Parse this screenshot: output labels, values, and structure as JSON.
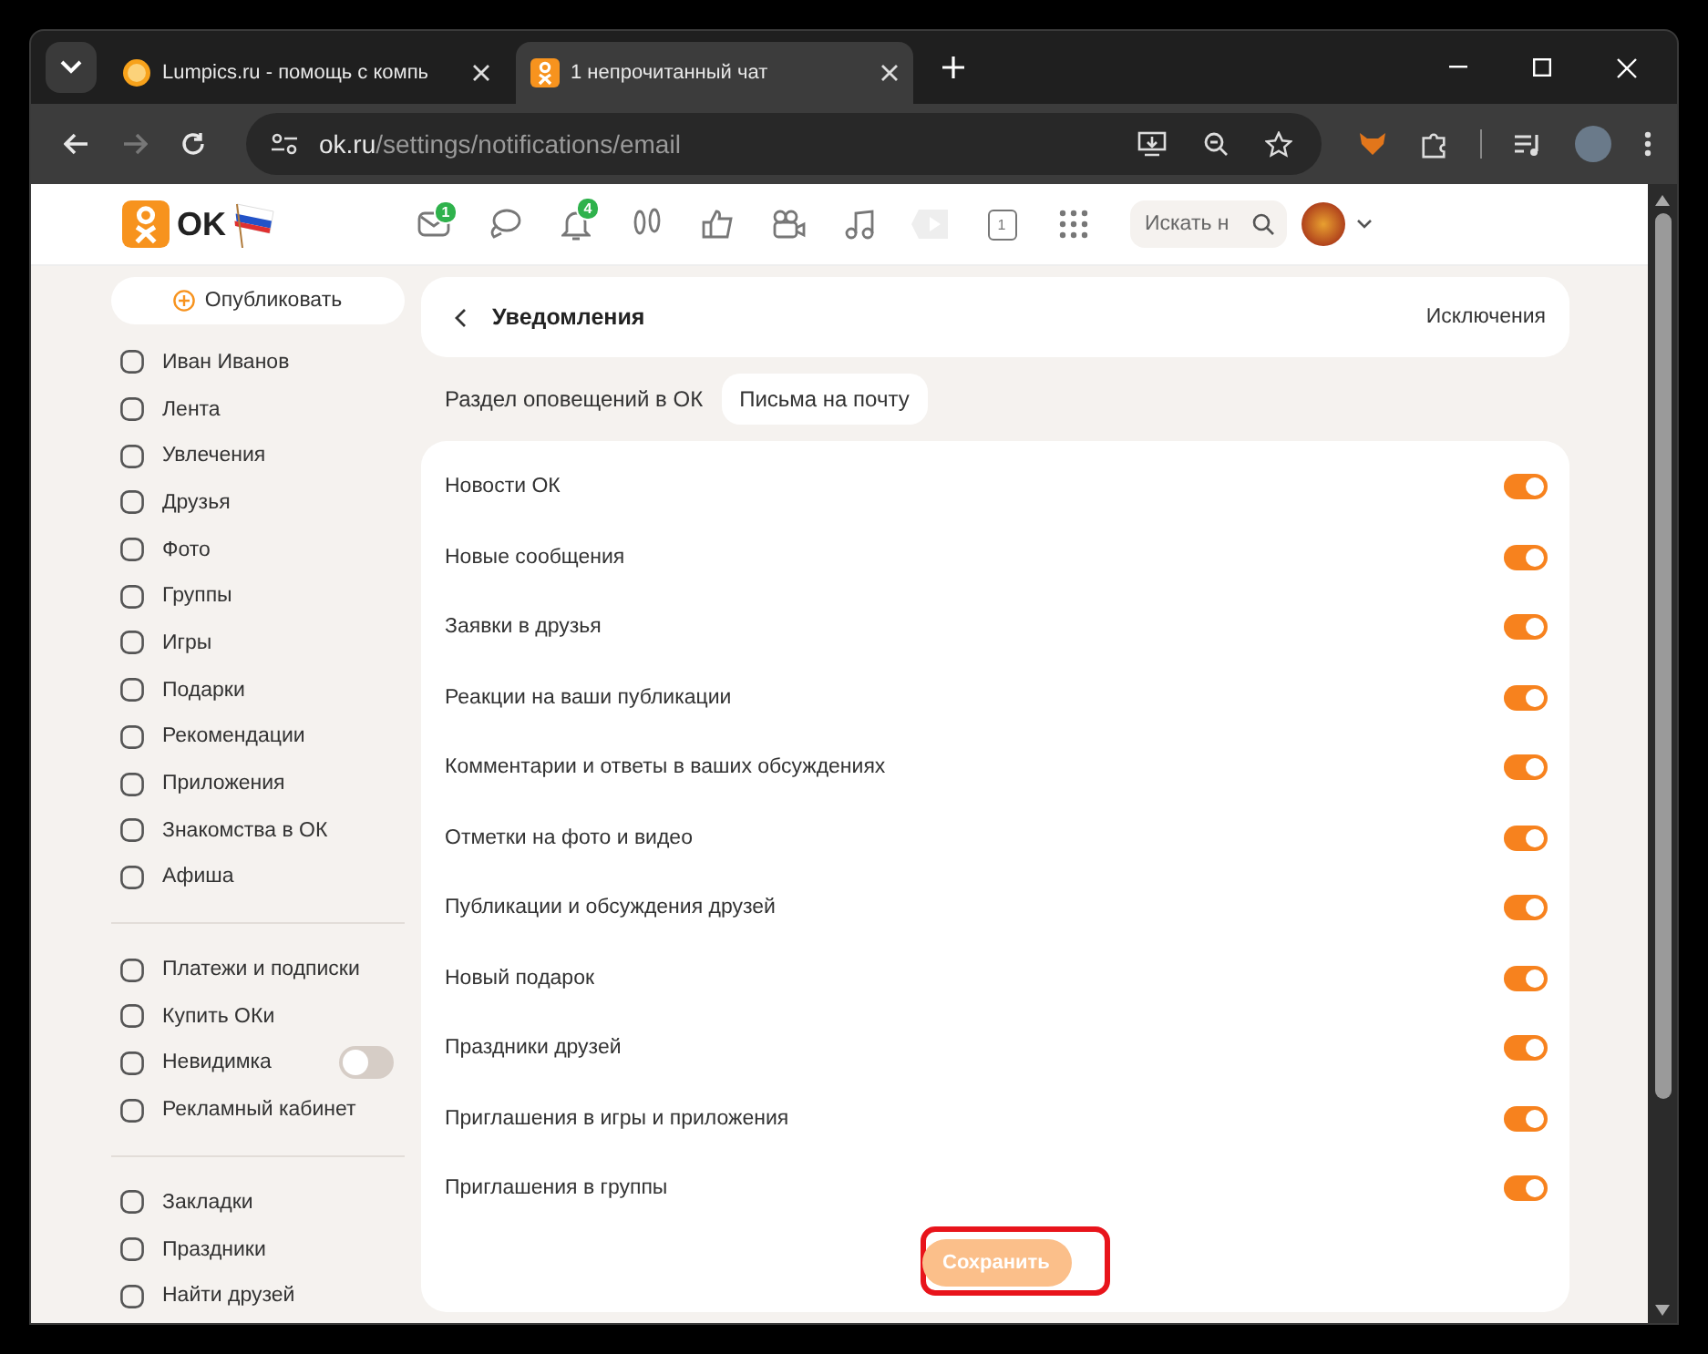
{
  "browser": {
    "tabs": [
      {
        "title": "Lumpics.ru - помощь с компь",
        "selected": false
      },
      {
        "title": "1 непрочитанный чат",
        "selected": true
      }
    ],
    "url_host": "ok.ru",
    "url_path": "/settings/notifications/email"
  },
  "header": {
    "logo": "OK",
    "nav": [
      {
        "kind": "mail",
        "badge": "1"
      },
      {
        "kind": "chat"
      },
      {
        "kind": "bell",
        "badge": "4"
      },
      {
        "kind": "steps"
      },
      {
        "kind": "like"
      },
      {
        "kind": "video"
      },
      {
        "kind": "music"
      },
      {
        "kind": "play"
      },
      {
        "kind": "calendar",
        "day": "1"
      },
      {
        "kind": "grid"
      }
    ],
    "search": {
      "placeholder": "Искать н"
    }
  },
  "sidebar": {
    "publish": "Опубликовать",
    "groups": [
      [
        {
          "label": "Иван Иванов",
          "kind": "link"
        },
        {
          "label": "Лента",
          "kind": "link"
        },
        {
          "label": "Увлечения",
          "kind": "link"
        },
        {
          "label": "Друзья",
          "kind": "link"
        },
        {
          "label": "Фото",
          "kind": "link"
        },
        {
          "label": "Группы",
          "kind": "link"
        },
        {
          "label": "Игры",
          "kind": "link"
        },
        {
          "label": "Подарки",
          "kind": "link"
        },
        {
          "label": "Рекомендации",
          "kind": "link"
        },
        {
          "label": "Приложения",
          "kind": "link"
        },
        {
          "label": "Знакомства в ОК",
          "kind": "link"
        },
        {
          "label": "Афиша",
          "kind": "link"
        }
      ],
      [
        {
          "label": "Платежи и подписки",
          "kind": "link"
        },
        {
          "label": "Купить ОКи",
          "kind": "link"
        },
        {
          "label": "Невидимка",
          "kind": "toggle",
          "on": false
        },
        {
          "label": "Рекламный кабинет",
          "kind": "link"
        }
      ],
      [
        {
          "label": "Закладки",
          "kind": "link"
        },
        {
          "label": "Праздники",
          "kind": "link"
        },
        {
          "label": "Найти друзей",
          "kind": "link"
        }
      ]
    ]
  },
  "panel": {
    "title": "Уведомления",
    "exceptions": "Исключения",
    "tabs": [
      {
        "label": "Раздел оповещений в ОК",
        "selected": false
      },
      {
        "label": "Письма на почту",
        "selected": true
      }
    ],
    "settings": [
      {
        "label": "Новости ОК",
        "on": true
      },
      {
        "label": "Новые сообщения",
        "on": true
      },
      {
        "label": "Заявки в друзья",
        "on": true
      },
      {
        "label": "Реакции на ваши публикации",
        "on": true
      },
      {
        "label": "Комментарии и ответы в ваших обсуждениях",
        "on": true
      },
      {
        "label": "Отметки на фото и видео",
        "on": true
      },
      {
        "label": "Публикации и обсуждения друзей",
        "on": true
      },
      {
        "label": "Новый подарок",
        "on": true
      },
      {
        "label": "Праздники друзей",
        "on": true
      },
      {
        "label": "Приглашения в игры и приложения",
        "on": true
      },
      {
        "label": "Приглашения в группы",
        "on": true
      }
    ],
    "save": {
      "label": "Сохранить",
      "disabled": true,
      "highlighted": true
    }
  }
}
